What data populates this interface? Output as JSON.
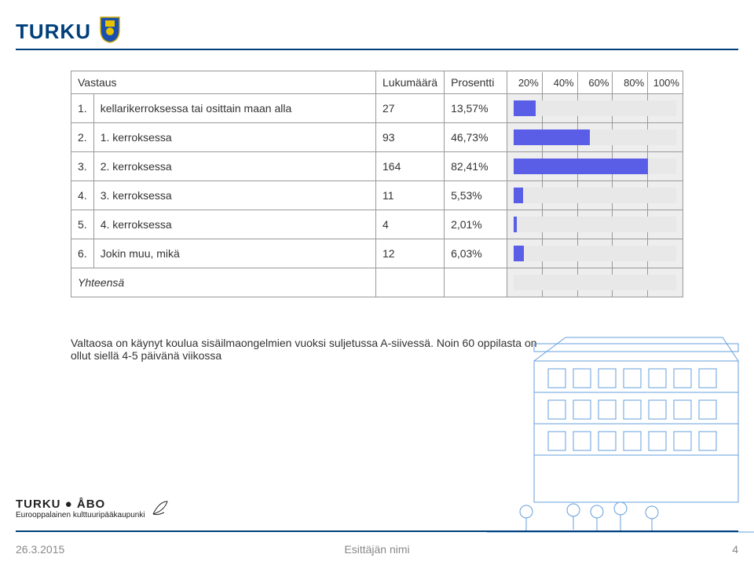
{
  "brand": "TURKU",
  "table": {
    "headers": {
      "vastaus": "Vastaus",
      "lukumaara": "Lukumäärä",
      "prosentti": "Prosentti"
    },
    "ticks": [
      "20%",
      "40%",
      "60%",
      "80%",
      "100%"
    ],
    "rows": [
      {
        "num": "1.",
        "label": "kellarikerroksessa tai osittain maan alla",
        "count": "27",
        "pct": "13,57%",
        "value": 13.57
      },
      {
        "num": "2.",
        "label": "1. kerroksessa",
        "count": "93",
        "pct": "46,73%",
        "value": 46.73
      },
      {
        "num": "3.",
        "label": "2. kerroksessa",
        "count": "164",
        "pct": "82,41%",
        "value": 82.41
      },
      {
        "num": "4.",
        "label": "3. kerroksessa",
        "count": "11",
        "pct": "5,53%",
        "value": 5.53
      },
      {
        "num": "5.",
        "label": "4. kerroksessa",
        "count": "4",
        "pct": "2,01%",
        "value": 2.01
      },
      {
        "num": "6.",
        "label": "Jokin muu, mikä",
        "count": "12",
        "pct": "6,03%",
        "value": 6.03
      }
    ],
    "total_label": "Yhteensä"
  },
  "note": "Valtaosa on käynyt koulua sisäilmaongelmien vuoksi suljetussa A-siivessä. Noin 60 oppilasta on ollut siellä 4-5 päivänä viikossa",
  "footer_logo": {
    "line1": "TURKU ● ÅBO",
    "line2": "Eurooppalainen kulttuuripääkaupunki"
  },
  "footer": {
    "date": "26.3.2015",
    "presenter": "Esittäjän nimi",
    "page": "4"
  },
  "chart_data": {
    "type": "bar",
    "title": "",
    "xlabel": "Prosentti",
    "ylabel": "Vastaus",
    "xlim": [
      0,
      100
    ],
    "categories": [
      "kellarikerroksessa tai osittain maan alla",
      "1. kerroksessa",
      "2. kerroksessa",
      "3. kerroksessa",
      "4. kerroksessa",
      "Jokin muu, mikä"
    ],
    "values": [
      13.57,
      46.73,
      82.41,
      5.53,
      2.01,
      6.03
    ],
    "counts": [
      27,
      93,
      164,
      11,
      4,
      12
    ]
  }
}
